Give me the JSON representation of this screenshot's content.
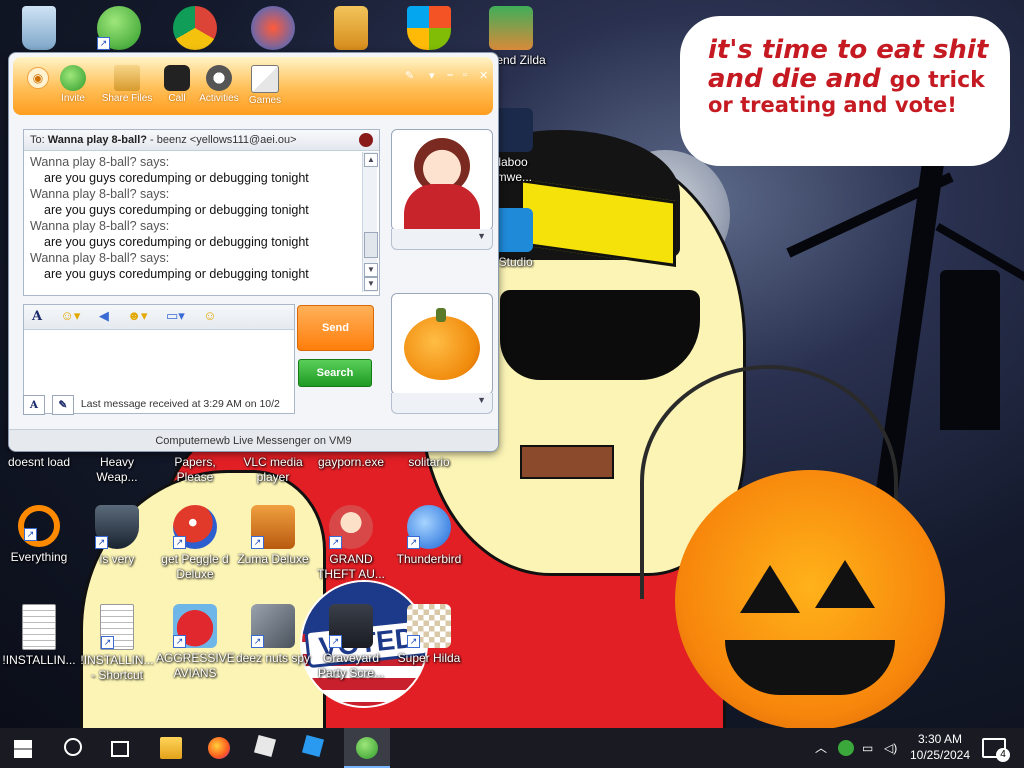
{
  "speech_bubble": {
    "line1": "it's time to eat shit",
    "line2a": "and die and",
    "line2b": "go trick",
    "line3": "or treating and vote!"
  },
  "flag_text": "VOTED",
  "desktop_icons": [
    {
      "label": "",
      "icon": "recycle-bin-icon"
    },
    {
      "label": "",
      "icon": "messenger-icon"
    },
    {
      "label": "",
      "icon": "chrome-icon"
    },
    {
      "label": "",
      "icon": "peggle-icon"
    },
    {
      "label": "",
      "icon": "folder-icon"
    },
    {
      "label": "",
      "icon": "windows-icon"
    },
    {
      "label": "Legend Zilda",
      "icon": "zelda-icon"
    },
    {
      "label": "daboo omwe...",
      "icon": "app-icon"
    },
    {
      "label": "x Studio",
      "icon": "studio-icon"
    },
    {
      "label": "doesnt load",
      "icon": "app-icon"
    },
    {
      "label": "Heavy Weap...",
      "icon": "game-icon"
    },
    {
      "label": "Papers, Please",
      "icon": "game-icon"
    },
    {
      "label": "VLC media player",
      "icon": "vlc-icon"
    },
    {
      "label": "gayporn.exe",
      "icon": "exe-icon"
    },
    {
      "label": "solitario",
      "icon": "cards-icon"
    },
    {
      "label": "Everything",
      "icon": "search-ring-icon"
    },
    {
      "label": "is very",
      "icon": "shield-icon"
    },
    {
      "label": "get Peggle d Deluxe",
      "icon": "peggle-icon"
    },
    {
      "label": "Zuma Deluxe",
      "icon": "zuma-icon"
    },
    {
      "label": "GRAND THEFT AU...",
      "icon": "gta-icon"
    },
    {
      "label": "Thunderbird",
      "icon": "thunderbird-icon"
    },
    {
      "label": "!INSTALLIN...",
      "icon": "document-icon"
    },
    {
      "label": "!INSTALLIN... - Shortcut",
      "icon": "document-icon"
    },
    {
      "label": "AGGRESSIVE AVIANS",
      "icon": "angry-bird-icon"
    },
    {
      "label": "deez nuts spy",
      "icon": "windows-stack-icon"
    },
    {
      "label": "Graveyard Party Scre...",
      "icon": "graveyard-icon"
    },
    {
      "label": "Super Hilda",
      "icon": "pixel-icon"
    }
  ],
  "messenger": {
    "toolbar": [
      "Invite",
      "Share Files",
      "Call",
      "Activities",
      "Games"
    ],
    "to_prefix": "To:",
    "contact_name": "Wanna play 8-ball?",
    "contact_detail": "- beenz <yellows111@aei.ou>",
    "messages": [
      {
        "from": "Wanna play 8-ball? says:",
        "text": "are you guys coredumping or debugging tonight"
      },
      {
        "from": "Wanna play 8-ball? says:",
        "text": "are you guys coredumping or debugging tonight"
      },
      {
        "from": "Wanna play 8-ball? says:",
        "text": "are you guys coredumping or debugging tonight"
      },
      {
        "from": "Wanna play 8-ball? says:",
        "text": "are you guys coredumping or debugging tonight"
      }
    ],
    "send_label": "Send",
    "search_label": "Search",
    "status_text": "Last message received at 3:29 AM on 10/2",
    "footer": "Computernewb Live Messenger on VM9",
    "font_button": "A"
  },
  "taskbar": {
    "clock_time": "3:30 AM",
    "clock_date": "10/25/2024",
    "notification_count": "4"
  },
  "colors": {
    "accent_orange": "#ff9d20",
    "search_green": "#1f9a22",
    "taskbar": "#1a1b22",
    "shirt_red": "#e21f25"
  }
}
